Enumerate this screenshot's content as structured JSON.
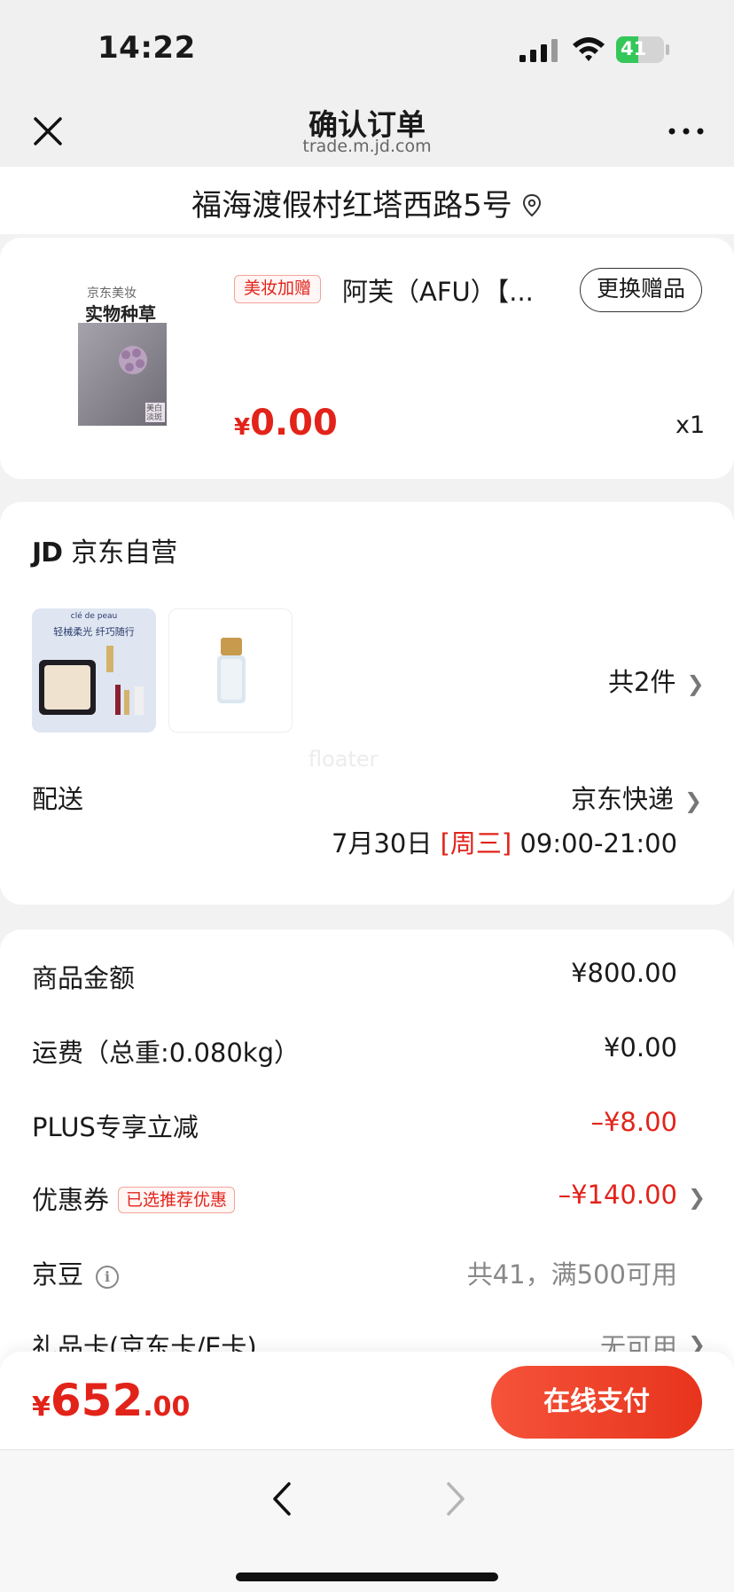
{
  "status_bar": {
    "time": "14:22",
    "battery": "41"
  },
  "header": {
    "title": "确认订单",
    "subtitle": "trade.m.jd.com"
  },
  "address": {
    "text": "福海渡假村红塔西路5号"
  },
  "gift_item": {
    "tag": "美妆加赠",
    "name": "阿芙（AFU）【...",
    "change_button": "更换赠品",
    "price_symbol": "¥",
    "price": "0.00",
    "quantity": "x1",
    "image_text": {
      "brand": "京东美妆",
      "headline": "实物种草",
      "badge": "美白淡斑"
    }
  },
  "store": {
    "logo": "JD",
    "name": "京东自营",
    "item_count": "共2件",
    "watermark": "floater",
    "shipping_label": "配送",
    "carrier": "京东快递",
    "date_prefix": "7月30日",
    "date_weekday": "[周三]",
    "date_time": "09:00-21:00",
    "product_image_text": {
      "brand": "clé de peau",
      "headline": "轻械柔光 纤巧随行"
    }
  },
  "price_rows": [
    {
      "label": "商品金额",
      "value": "¥800.00"
    },
    {
      "label": "运费（总重:0.080kg）",
      "value": "¥0.00"
    },
    {
      "label": "PLUS专享立减",
      "value": "–¥8.00"
    },
    {
      "label": "优惠券",
      "tag": "已选推荐优惠",
      "value": "–¥140.00"
    },
    {
      "label": "京豆",
      "info_icon": "i",
      "value": "共41，满500可用"
    },
    {
      "label": "礼品卡(京东卡/E卡)",
      "value": "无可用"
    }
  ],
  "footer": {
    "total_symbol": "¥",
    "total_int": "652",
    "total_dec": ".00",
    "pay_button": "在线支付"
  },
  "colors": {
    "accent": "#e2231a",
    "pay_button": "#f04b2f"
  }
}
